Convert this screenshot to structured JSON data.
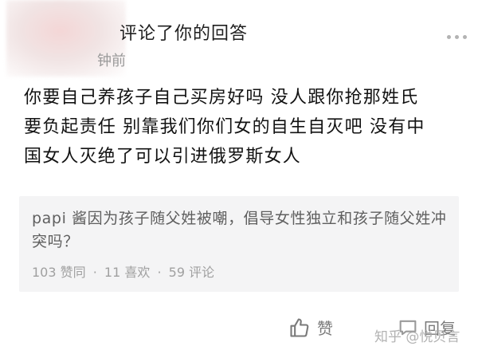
{
  "notification": {
    "action_text": "评论了你的回答",
    "time_text": "钟前"
  },
  "comment": {
    "lines": [
      "你要自己养孩子自己买房好吗 没人跟你抢那姓氏",
      "要负起责任 别靠我们你们女的自生自灭吧 没有中",
      "国女人灭绝了可以引进俄罗斯女人"
    ]
  },
  "quoted_answer": {
    "title": "papi 酱因为孩子随父姓被嘲，倡导女性独立和孩子随父姓冲突吗？",
    "likes": "103 赞同",
    "favorites": "11 喜欢",
    "comments": "59 评论",
    "separator": "·"
  },
  "actions": {
    "like_label": "赞",
    "reply_label": "回复",
    "like_icon": "thumbs-up-icon",
    "reply_icon": "chat-bubble-icon"
  },
  "watermark": "知乎 @悦贝言"
}
